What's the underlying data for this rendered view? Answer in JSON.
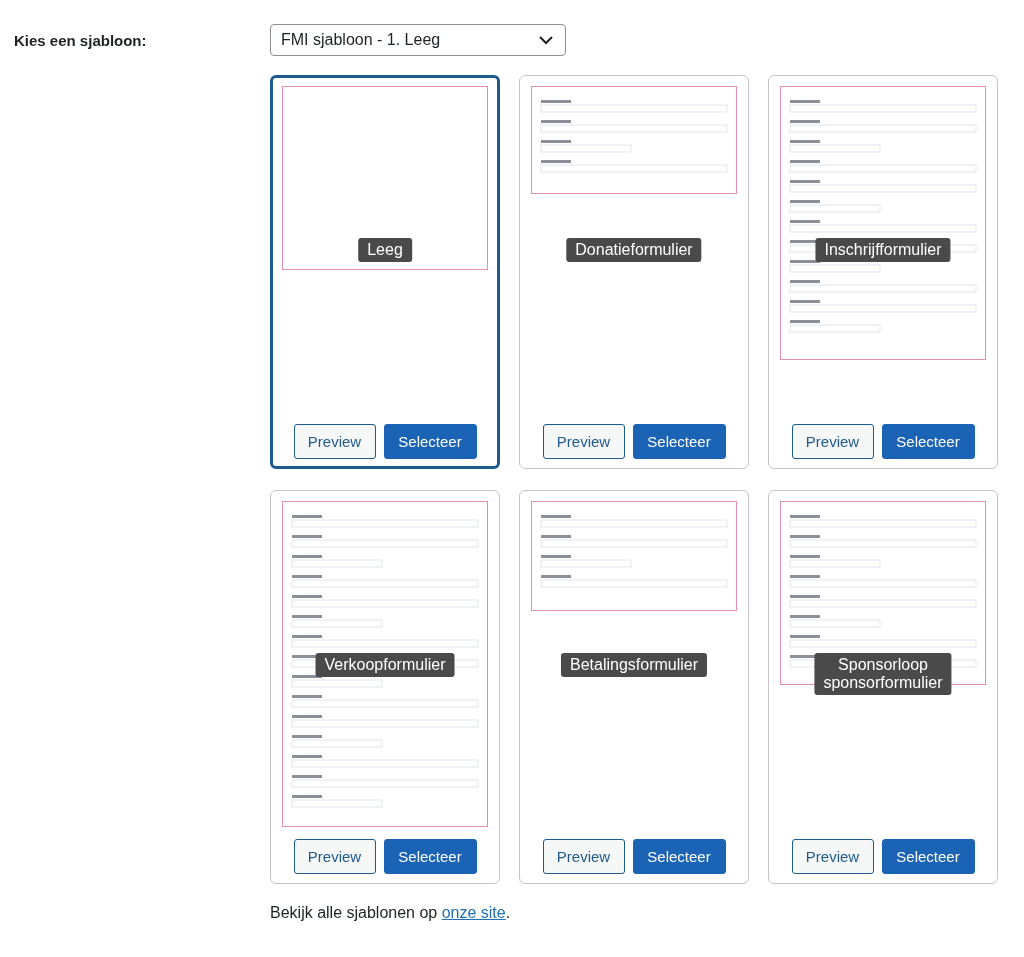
{
  "label": "Kies een sjabloon:",
  "select": {
    "value": "FMI sjabloon - 1. Leeg"
  },
  "templates": [
    {
      "name": "Leeg",
      "selected": true,
      "preview": "Preview",
      "select": "Selecteer"
    },
    {
      "name": "Donatieformulier",
      "selected": false,
      "preview": "Preview",
      "select": "Selecteer"
    },
    {
      "name": "Inschrijfformulier",
      "selected": false,
      "preview": "Preview",
      "select": "Selecteer"
    },
    {
      "name": "Verkoopformulier",
      "selected": false,
      "preview": "Preview",
      "select": "Selecteer"
    },
    {
      "name": "Betalingsformulier",
      "selected": false,
      "preview": "Preview",
      "select": "Selecteer"
    },
    {
      "name": "Sponsorloop sponsorformulier",
      "selected": false,
      "preview": "Preview",
      "select": "Selecteer"
    }
  ],
  "footer": {
    "text": "Bekijk alle sjablonen op ",
    "link": "onze site",
    "end": "."
  }
}
